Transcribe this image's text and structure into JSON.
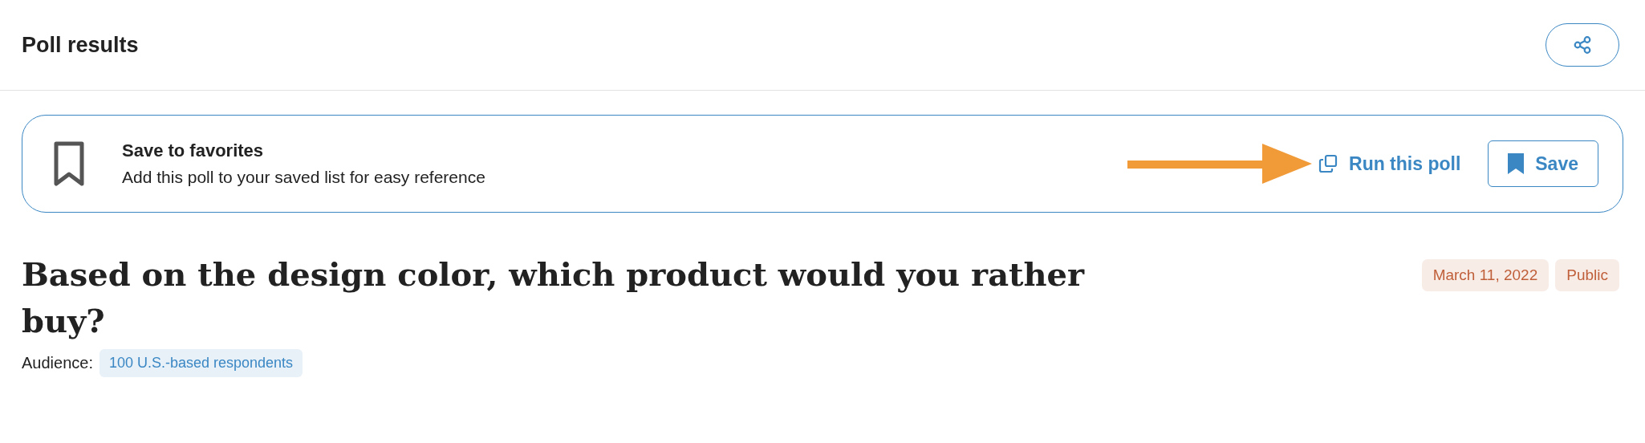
{
  "header": {
    "title": "Poll results"
  },
  "favorites": {
    "title": "Save to favorites",
    "description": "Add this poll to your saved list for easy reference",
    "run_label": "Run this poll",
    "save_label": "Save"
  },
  "poll": {
    "question": "Based on the design color, which product would you rather buy?",
    "tags": [
      "March 11, 2022",
      "Public"
    ],
    "audience_label": "Audience:",
    "audience": "100 U.S.-based respondents"
  }
}
